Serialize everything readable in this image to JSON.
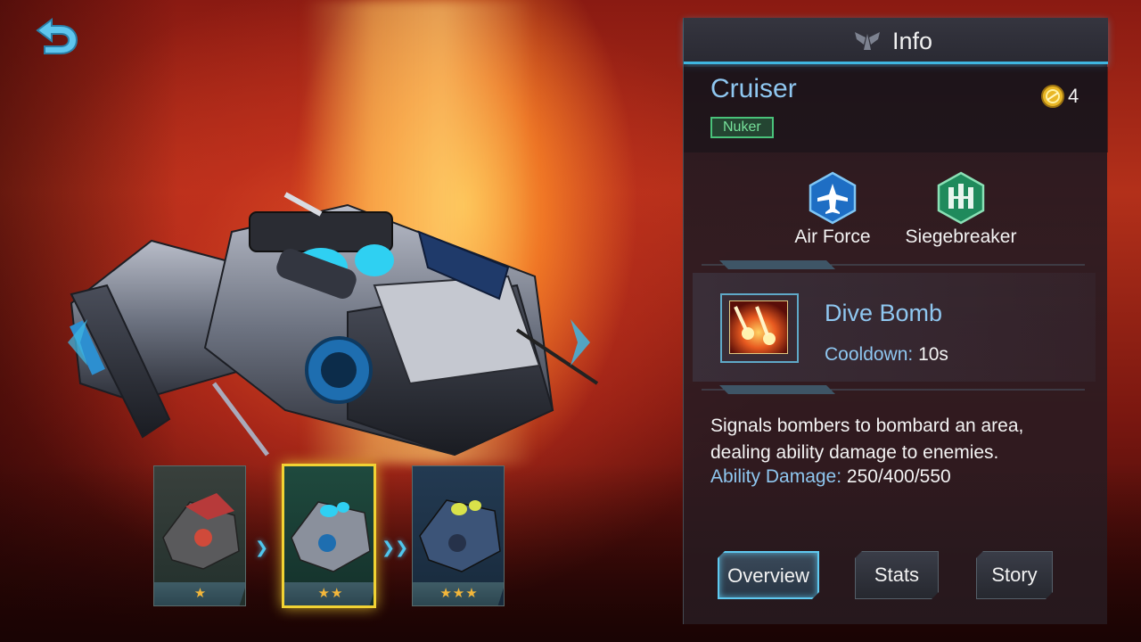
{
  "info_panel": {
    "title": "Info",
    "hero": {
      "name": "Cruiser",
      "role": "Nuker",
      "cost": "4"
    },
    "traits": [
      {
        "label": "Air Force",
        "icon": "jet-icon",
        "color": "#1e6ec4"
      },
      {
        "label": "Siegebreaker",
        "icon": "fortress-icon",
        "color": "#1f8a5c"
      }
    ],
    "skill": {
      "name": "Dive Bomb",
      "cooldown_label": "Cooldown:",
      "cooldown_value": "10s",
      "description": "Signals bombers to bombard an area, dealing ability damage to enemies.",
      "damage_label": "Ability Damage:",
      "damage_value": "250/400/550"
    },
    "tabs": [
      {
        "label": "Overview",
        "active": true
      },
      {
        "label": "Stats",
        "active": false
      },
      {
        "label": "Story",
        "active": false
      }
    ]
  },
  "evolution": [
    {
      "stars": "★",
      "level": 1
    },
    {
      "stars": "★★",
      "level": 2,
      "selected": true
    },
    {
      "stars": "★★★",
      "level": 3
    }
  ],
  "colors": {
    "accent": "#3fb6e0",
    "name_blue": "#8fc7f0",
    "role_green": "#49c27a",
    "star_gold": "#f4b73a",
    "selected_border": "#f1d233"
  }
}
